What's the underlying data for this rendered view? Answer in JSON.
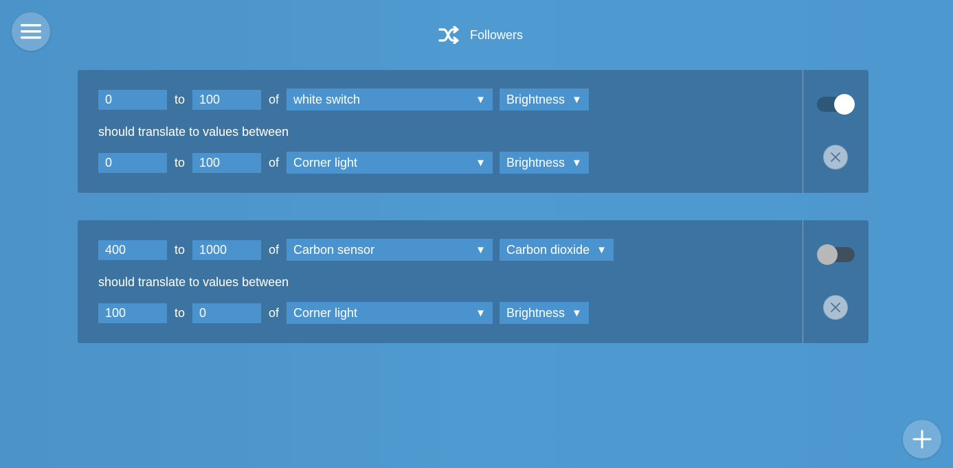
{
  "header": {
    "title": "Followers",
    "icon": "shuffle-icon"
  },
  "followers": [
    {
      "source": {
        "from": "0",
        "to": "100",
        "device": "white switch",
        "property": "Brightness"
      },
      "translate_text": "should translate to values between",
      "target": {
        "from": "0",
        "to": "100",
        "device": "Corner light",
        "property": "Brightness"
      },
      "enabled": true
    },
    {
      "source": {
        "from": "400",
        "to": "1000",
        "device": "Carbon sensor",
        "property": "Carbon dioxide"
      },
      "translate_text": "should translate to values between",
      "target": {
        "from": "100",
        "to": "0",
        "device": "Corner light",
        "property": "Brightness"
      },
      "enabled": false
    }
  ],
  "labels": {
    "to": "to",
    "of": "of"
  },
  "colors": {
    "background": "#4f9ad0",
    "card": "#3d73a0",
    "field": "#4a93cf"
  }
}
